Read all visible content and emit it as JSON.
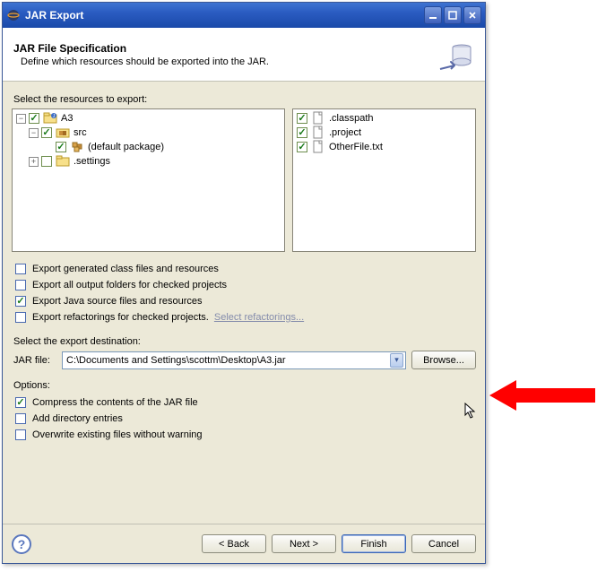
{
  "window": {
    "title": "JAR Export"
  },
  "banner": {
    "heading": "JAR File Specification",
    "sub": "Define which resources should be exported into the JAR."
  },
  "resources": {
    "label": "Select the resources to export:",
    "left": {
      "root": "A3",
      "src": "src",
      "defaultpkg": "(default package)",
      "settings": ".settings"
    },
    "right": {
      "classpath": ".classpath",
      "project": ".project",
      "other": "OtherFile.txt"
    }
  },
  "options": {
    "genClass": "Export generated class files and resources",
    "outFolders": "Export all output folders for checked projects",
    "javaSrc": "Export Java source files and resources",
    "refactor": "Export refactorings for checked projects.",
    "refactorLink": "Select refactorings..."
  },
  "destination": {
    "sectionLabel": "Select the export destination:",
    "prefix": "JAR file:",
    "path": "C:\\Documents and Settings\\scottm\\Desktop\\A3.jar",
    "browse": "Browse..."
  },
  "options2": {
    "sectionLabel": "Options:",
    "compress": "Compress the contents of the JAR file",
    "addDir": "Add directory entries",
    "overwrite": "Overwrite existing files without warning"
  },
  "footer": {
    "back": "< Back",
    "next": "Next >",
    "finish": "Finish",
    "cancel": "Cancel"
  }
}
